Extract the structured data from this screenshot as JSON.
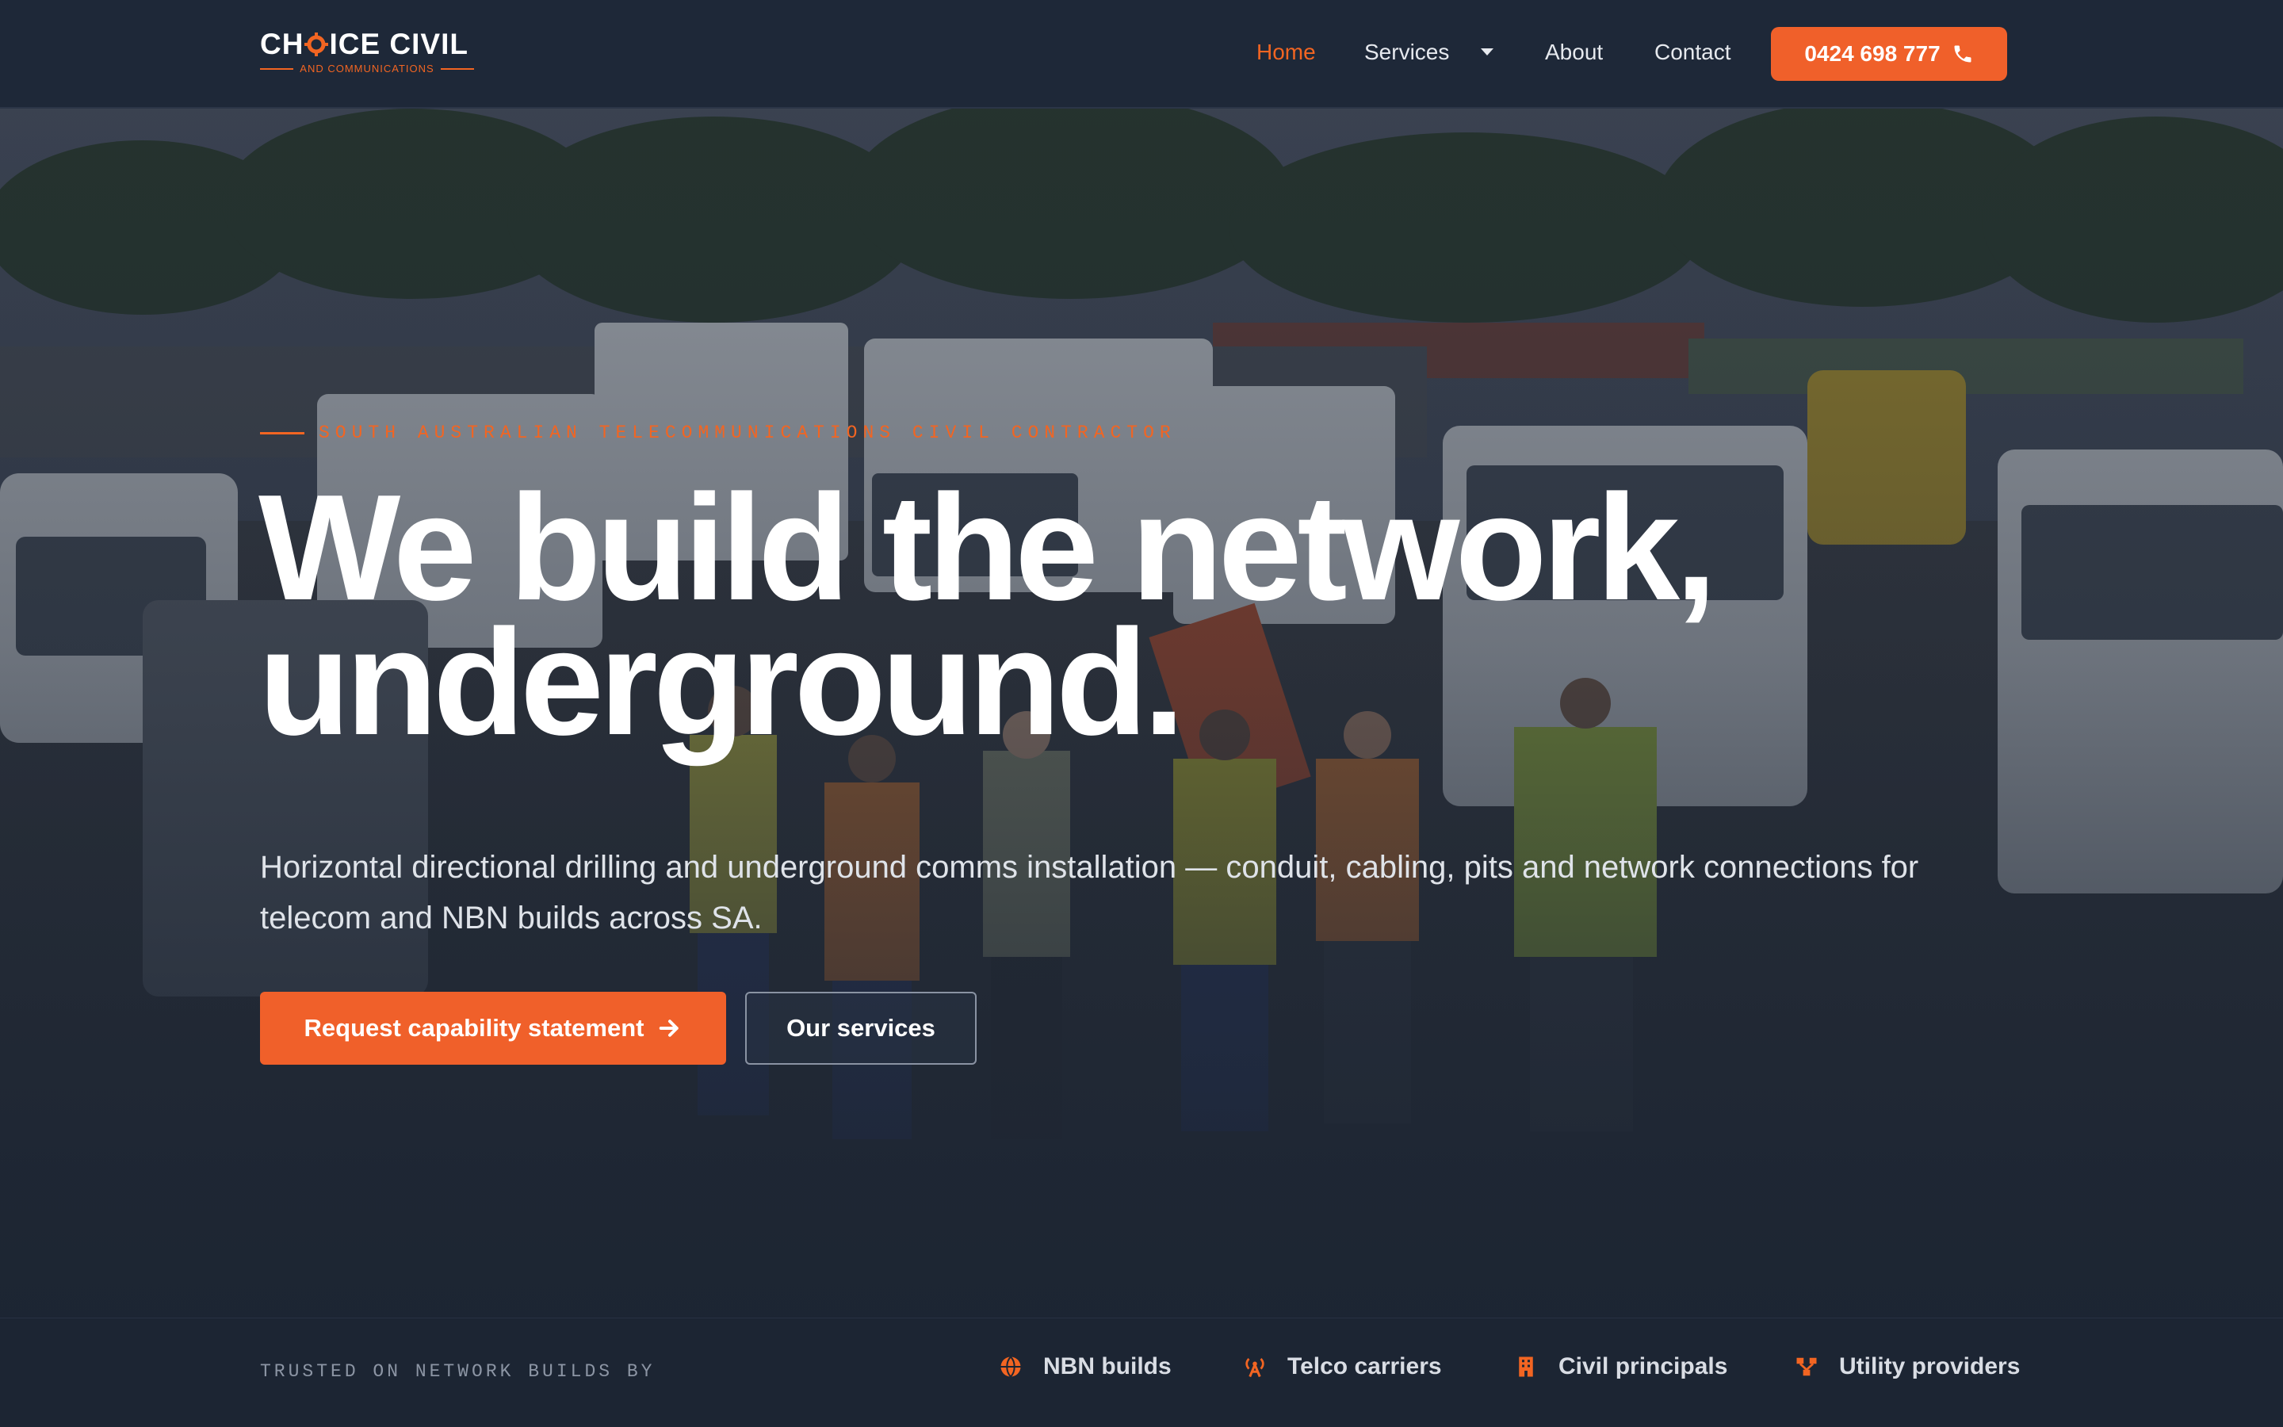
{
  "brand": {
    "logo_main_left": "CH",
    "logo_main_right": "ICE CIVIL",
    "logo_sub": "AND COMMUNICATIONS",
    "accent_color": "#f26522"
  },
  "nav": {
    "items": [
      {
        "label": "Home",
        "active": true
      },
      {
        "label": "Services",
        "active": false
      },
      {
        "label": "About",
        "active": false
      },
      {
        "label": "Contact",
        "active": false
      }
    ],
    "phone_label": "0424 698 777",
    "phone_icon": "phone-icon"
  },
  "hero": {
    "eyebrow": "SOUTH AUSTRALIAN TELECOMMUNICATIONS CIVIL CONTRACTOR",
    "headline_line1": "We build the network,",
    "headline_line2": "underground.",
    "subtext": "Horizontal directional drilling and underground comms installation — conduit, cabling, pits and network connections for telecom and NBN builds across SA.",
    "primary_cta": "Request capability statement",
    "secondary_cta": "Our services"
  },
  "trust": {
    "label": "TRUSTED ON NETWORK BUILDS BY",
    "items": [
      {
        "label": "NBN builds",
        "icon": "globe-icon"
      },
      {
        "label": "Telco carriers",
        "icon": "antenna-icon"
      },
      {
        "label": "Civil principals",
        "icon": "building-icon"
      },
      {
        "label": "Utility providers",
        "icon": "network-icon"
      }
    ]
  }
}
